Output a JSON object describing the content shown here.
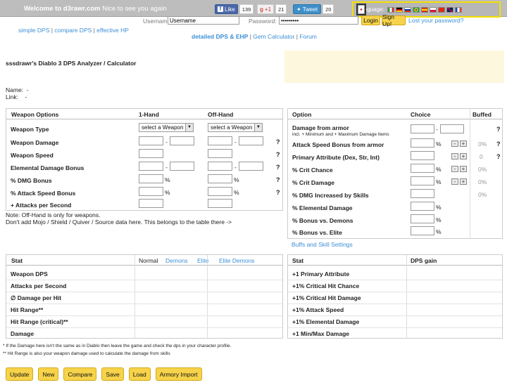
{
  "welcome": {
    "site": "Welcome to d3rawr.com",
    "msg": "Nice to see you again"
  },
  "social": {
    "fb_label": "Like",
    "fb_count": "139",
    "gplus_label": "+1",
    "gplus_count": "21",
    "tw_label": "Tweet",
    "tw_count": "20"
  },
  "language": {
    "label": "Language:",
    "flags": [
      "#2a9d3a",
      "#e03a2a",
      "#c8102e",
      "#2d8a3a",
      "#ffffff",
      "#f1bf00",
      "#d32f2f",
      "#c8102e",
      "#b22234",
      "#0055a4"
    ]
  },
  "login": {
    "username_label": "Username:",
    "username_value": "Username",
    "password_label": "Password:",
    "password_value": "•••••••••",
    "login_btn": "Login",
    "signup_btn": "Sign Up!",
    "lost_pw": "Lost your password?"
  },
  "nav": {
    "simple_dps": "simple DPS",
    "compare_dps": "compare DPS",
    "effective_hp": "effective HP",
    "sep": "|",
    "detailed": "detailed DPS & EHP",
    "gem_calc": "Gem Calculator",
    "forum": "Forum"
  },
  "title": "sssdrawr's Diablo 3 DPS Analyzer / Calculator",
  "name_label": "Name:",
  "name_value": "-",
  "link_label": "Link:",
  "link_value": "-",
  "weapon": {
    "h_options": "Weapon Options",
    "h_1hand": "1-Hand",
    "h_offhand": "Off-Hand",
    "type": "Weapon Type",
    "select": "select a Weapon",
    "damage": "Weapon Damage",
    "speed": "Weapon Speed",
    "elemental": "Elemental Damage Bonus",
    "dmg_bonus": "% DMG Bonus",
    "as_bonus": "% Attack Speed Bonus",
    "attacks": "+ Attacks per Second",
    "pct": "%",
    "dash": "-",
    "q": "?"
  },
  "note1": "Note: Off-Hand is only for weapons.",
  "note2": "Don't add Mojo / Shield / Quiver / Source data here. This belongs to the table there ->",
  "options": {
    "h_option": "Option",
    "h_choice": "Choice",
    "h_buffed": "Buffed",
    "dfa": "Damage from armor",
    "dfa_sub": "incl. + Minimum and + Maximum Damage Items",
    "asfa": "Attack Speed Bonus from armor",
    "primary": "Primary Attribute (Dex, Str, Int)",
    "crit_chance": "% Crit Chance",
    "crit_damage": "% Crit Damage",
    "inc_skills": "% DMG Increased by Skills",
    "elemental": "% Elemental Damage",
    "demons": "% Bonus vs. Demons",
    "elite": "% Bonus vs. Elite",
    "v_0pct": "0%",
    "v_0": "0",
    "minus": "-",
    "plus": "+",
    "pct": "%",
    "dash": "-",
    "q": "?",
    "buffs_link": "Buffs and Skill Settings"
  },
  "stats": {
    "h_stat": "Stat",
    "h_normal": "Normal",
    "h_demons": "Demons",
    "h_elite": "Elite",
    "h_elite_demons": "Elite Demons",
    "rows": [
      "Weapon DPS",
      "Attacks per Second",
      "∅ Damage per Hit",
      "Hit Range**",
      "Hit Range (critical)**",
      "Damage"
    ]
  },
  "gains": {
    "h_stat": "Stat",
    "h_gain": "DPS gain",
    "rows": [
      "+1 Primary Attribute",
      "+1% Critical Hit Chance",
      "+1% Critical Hit Damage",
      "+1% Attack Speed",
      "+1% Elemental Damage",
      "+1 Min/Max Damage"
    ]
  },
  "foot1": "* If the Damage here isn't the same as in Diablo then leave the game and check the dps in your character profile.",
  "foot2": "** Hit Range is also your weapon damage used to calculate the damage from skills",
  "buttons": {
    "update": "Update",
    "new": "New",
    "compare": "Compare",
    "save": "Save",
    "load": "Load",
    "armory": "Armory Import"
  }
}
